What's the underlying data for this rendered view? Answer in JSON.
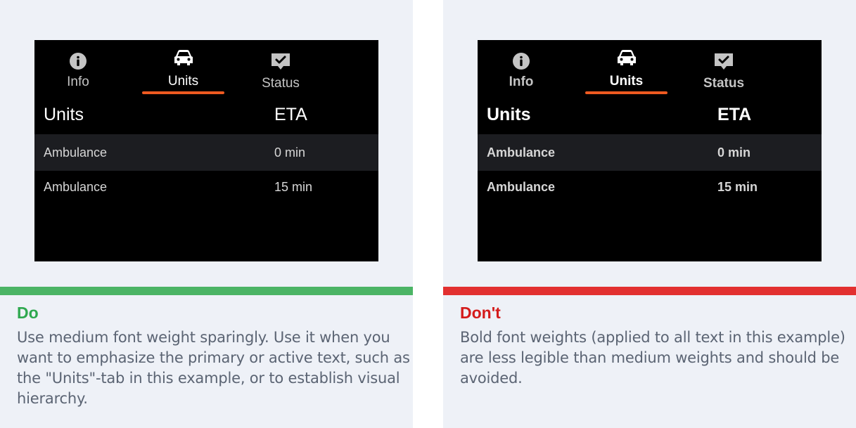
{
  "examples": [
    {
      "verdict": "Do",
      "bar_color": "#4bb465",
      "description": "Use medium font weight sparingly. Use it when you want to emphasize the primary or active text, such as the \"Units\"-tab in this example, or to establish visual hierarchy.",
      "tabs": [
        {
          "label": "Info",
          "icon": "info-icon",
          "active": false
        },
        {
          "label": "Units",
          "icon": "car-icon",
          "active": true
        },
        {
          "label": "Status",
          "icon": "status-check-icon",
          "active": false
        }
      ],
      "table": {
        "headers": [
          "Units",
          "ETA"
        ],
        "rows": [
          [
            "Ambulance",
            "0 min"
          ],
          [
            "Ambulance",
            "15 min"
          ]
        ]
      }
    },
    {
      "verdict": "Don't",
      "bar_color": "#e23030",
      "description": "Bold font weights (applied to all text in this example) are less legible than medium weights and should be avoided.",
      "tabs": [
        {
          "label": "Info",
          "icon": "info-icon",
          "active": false
        },
        {
          "label": "Units",
          "icon": "car-icon",
          "active": true
        },
        {
          "label": "Status",
          "icon": "status-check-icon",
          "active": false
        }
      ],
      "table": {
        "headers": [
          "Units",
          "ETA"
        ],
        "rows": [
          [
            "Ambulance",
            "0 min"
          ],
          [
            "Ambulance",
            "15 min"
          ]
        ]
      }
    }
  ],
  "accent_color": "#ee5a21"
}
